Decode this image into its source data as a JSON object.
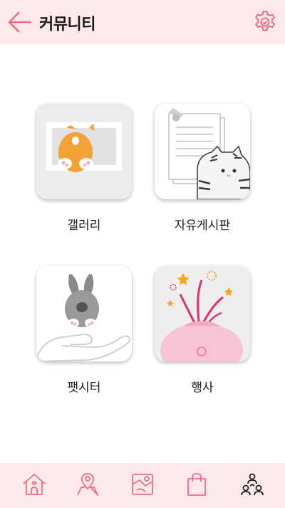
{
  "header": {
    "title": "커뮤니티",
    "back_icon": "arrow-left-icon",
    "settings_icon": "gear-icon"
  },
  "menu": [
    {
      "id": "gallery",
      "label": "갤러리",
      "icon": "gallery-corgi-icon"
    },
    {
      "id": "free-board",
      "label": "자유게시판",
      "icon": "board-cat-icon"
    },
    {
      "id": "petsitter",
      "label": "팻시터",
      "icon": "petsitter-rabbit-icon"
    },
    {
      "id": "events",
      "label": "행사",
      "icon": "event-pig-icon"
    }
  ],
  "tabbar": [
    {
      "id": "home",
      "icon": "home-icon",
      "active": false
    },
    {
      "id": "map",
      "icon": "map-pin-icon",
      "active": false
    },
    {
      "id": "route",
      "icon": "route-map-icon",
      "active": false
    },
    {
      "id": "shop",
      "icon": "shopping-bag-icon",
      "active": false
    },
    {
      "id": "community",
      "icon": "community-icon",
      "active": true
    }
  ],
  "colors": {
    "header_bg": "#fde9ec",
    "accent": "#e8707e",
    "active_tab": "#222222"
  }
}
